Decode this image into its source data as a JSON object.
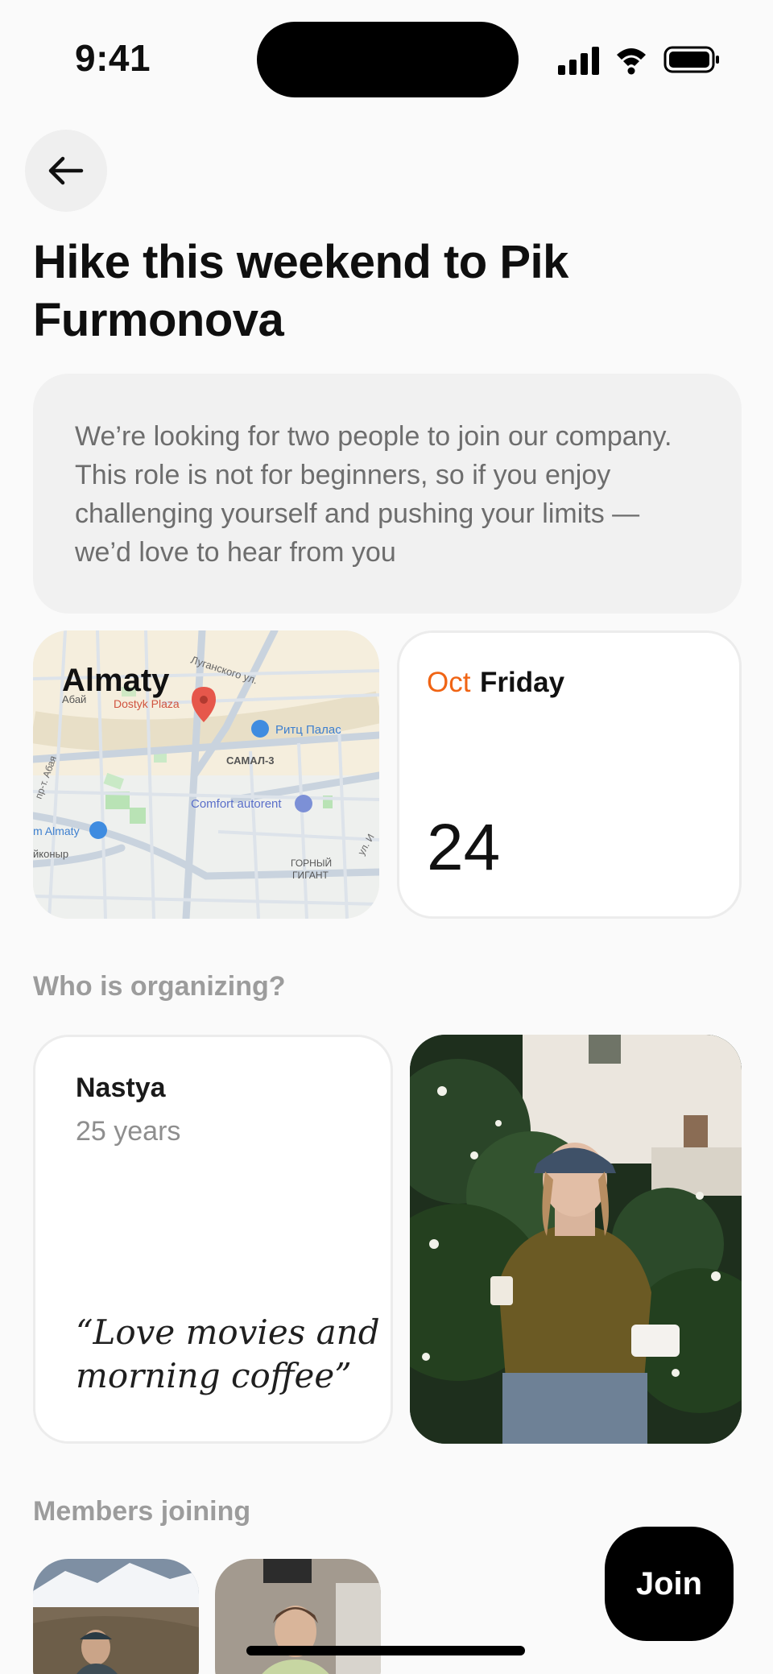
{
  "status_bar": {
    "time": "9:41"
  },
  "page": {
    "title": "Hike this weekend to Pik Furmonova"
  },
  "description": "We’re looking for two people to join our company. This role is not for beginners, so if you enjoy challenging yourself and pushing your limits — we’d love to hear from you",
  "map": {
    "city": "Almaty",
    "labels": {
      "dostyk": "Dostyk Plaza",
      "ritz": "Ритц Палас",
      "samal": "САМАЛ-3",
      "comfort": "Comfort autorent",
      "almaty_m": "m Almaty",
      "abai": "Абай",
      "lugansk": "Луганского ул.",
      "prabaj": "пр-т. Абая",
      "gornyi1": "ГОРНЫЙ",
      "gornyi2": "ГИГАНТ",
      "koryr": "йконыр",
      "ul": "ул. И"
    }
  },
  "date": {
    "month": "Oct",
    "weekday": "Friday",
    "day": "24"
  },
  "organizer": {
    "heading": "Who is organizing?",
    "name": "Nastya",
    "age": "25 years",
    "quote": "“Love movies and morning coffee”"
  },
  "members": {
    "heading": "Members joining"
  },
  "join_button": "Join",
  "colors": {
    "accent": "#f06414",
    "background": "#fafafa",
    "button": "#000000"
  }
}
